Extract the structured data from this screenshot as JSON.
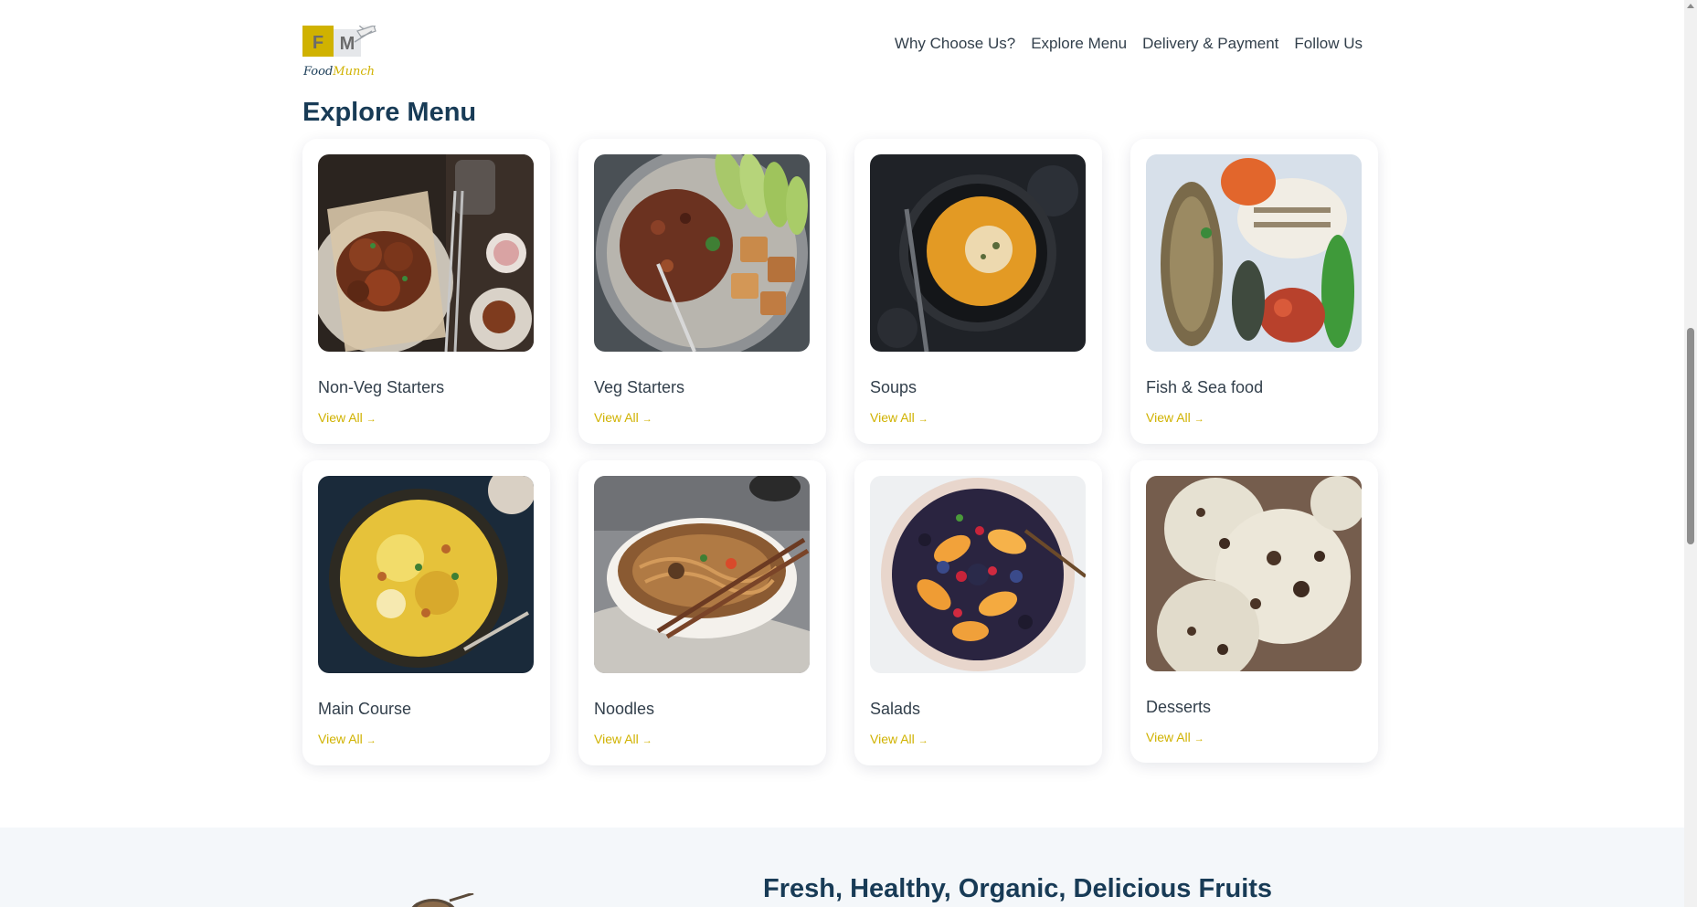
{
  "brand": {
    "initial_1": "F",
    "initial_2": "M",
    "name_part_1": "Food",
    "name_part_2": "Munch",
    "accent_color": "#d0b200",
    "heading_color": "#183b56"
  },
  "nav": {
    "links": [
      "Why Choose Us?",
      "Explore Menu",
      "Delivery & Payment",
      "Follow Us"
    ]
  },
  "explore_menu": {
    "title": "Explore Menu",
    "link_label": "View All",
    "link_icon": "arrow-right-icon",
    "items": [
      {
        "title": "Non-Veg Starters",
        "image": "fried-chicken-image"
      },
      {
        "title": "Veg Starters",
        "image": "tofu-avocado-bowl-image"
      },
      {
        "title": "Soups",
        "image": "pumpkin-soup-image"
      },
      {
        "title": "Fish & Sea food",
        "image": "grilled-fish-platter-image"
      },
      {
        "title": "Main Course",
        "image": "biryani-image"
      },
      {
        "title": "Noodles",
        "image": "noodle-bowl-image"
      },
      {
        "title": "Salads",
        "image": "fruit-salad-image"
      },
      {
        "title": "Desserts",
        "image": "ice-cream-scoops-image"
      }
    ]
  },
  "fruits_section": {
    "title": "Fresh, Healthy, Organic, Delicious Fruits"
  }
}
